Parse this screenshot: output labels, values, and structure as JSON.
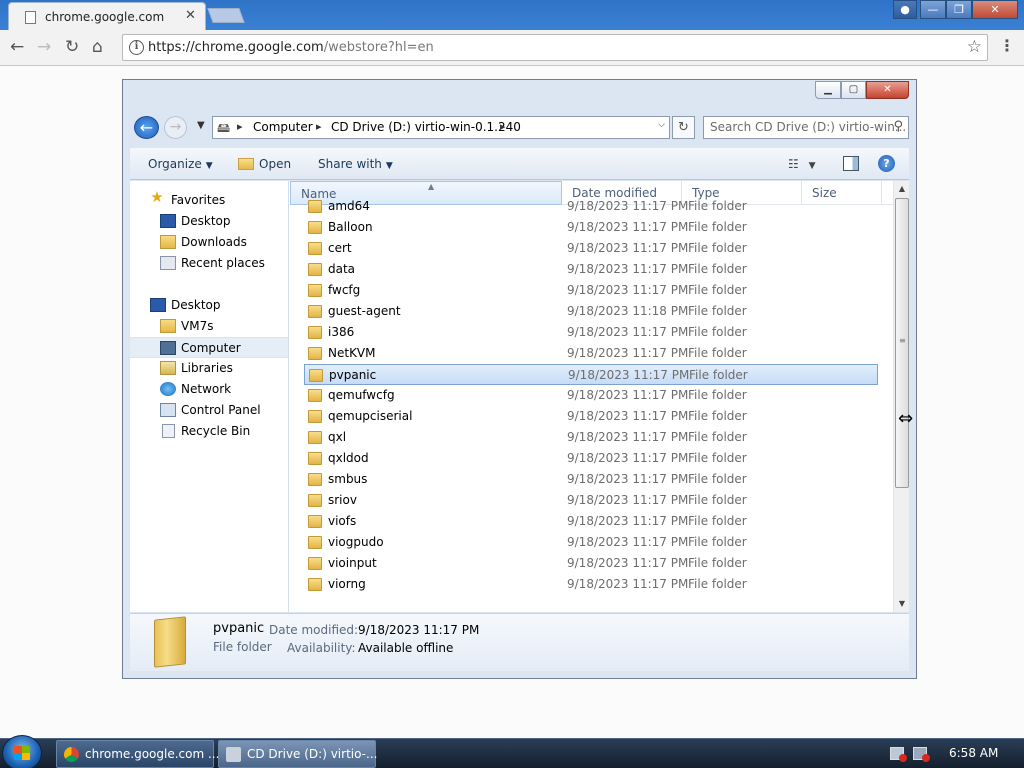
{
  "browser": {
    "tab_title": "chrome.google.com",
    "tab_close": "✕",
    "url_host": "https://chrome.google.com",
    "url_path": "/webstore?hl=en",
    "window_buttons": {
      "min": "—",
      "max": "❐",
      "close": "✕"
    }
  },
  "explorer": {
    "address": {
      "crumbs": [
        "Computer",
        "CD Drive (D:) virtio-win-0.1.240"
      ]
    },
    "search_placeholder": "Search CD Drive (D:) virtio-win...",
    "commands": {
      "organize": "Organize",
      "open": "Open",
      "share_with": "Share with"
    },
    "nav": {
      "favorites": "Favorites",
      "favorites_items": [
        "Desktop",
        "Downloads",
        "Recent places"
      ],
      "desktop": "Desktop",
      "desktop_items": [
        "VM7s",
        "Computer",
        "Libraries",
        "Network",
        "Control Panel",
        "Recycle Bin"
      ],
      "selected": "Computer"
    },
    "columns": {
      "name": "Name",
      "date": "Date modified",
      "type": "Type",
      "size": "Size"
    },
    "files": [
      {
        "name": "amd64",
        "date": "9/18/2023 11:17 PM",
        "type": "File folder"
      },
      {
        "name": "Balloon",
        "date": "9/18/2023 11:17 PM",
        "type": "File folder"
      },
      {
        "name": "cert",
        "date": "9/18/2023 11:17 PM",
        "type": "File folder"
      },
      {
        "name": "data",
        "date": "9/18/2023 11:17 PM",
        "type": "File folder"
      },
      {
        "name": "fwcfg",
        "date": "9/18/2023 11:17 PM",
        "type": "File folder"
      },
      {
        "name": "guest-agent",
        "date": "9/18/2023 11:18 PM",
        "type": "File folder"
      },
      {
        "name": "i386",
        "date": "9/18/2023 11:17 PM",
        "type": "File folder"
      },
      {
        "name": "NetKVM",
        "date": "9/18/2023 11:17 PM",
        "type": "File folder"
      },
      {
        "name": "pvpanic",
        "date": "9/18/2023 11:17 PM",
        "type": "File folder"
      },
      {
        "name": "qemufwcfg",
        "date": "9/18/2023 11:17 PM",
        "type": "File folder"
      },
      {
        "name": "qemupciserial",
        "date": "9/18/2023 11:17 PM",
        "type": "File folder"
      },
      {
        "name": "qxl",
        "date": "9/18/2023 11:17 PM",
        "type": "File folder"
      },
      {
        "name": "qxldod",
        "date": "9/18/2023 11:17 PM",
        "type": "File folder"
      },
      {
        "name": "smbus",
        "date": "9/18/2023 11:17 PM",
        "type": "File folder"
      },
      {
        "name": "sriov",
        "date": "9/18/2023 11:17 PM",
        "type": "File folder"
      },
      {
        "name": "viofs",
        "date": "9/18/2023 11:17 PM",
        "type": "File folder"
      },
      {
        "name": "viogpudo",
        "date": "9/18/2023 11:17 PM",
        "type": "File folder"
      },
      {
        "name": "vioinput",
        "date": "9/18/2023 11:17 PM",
        "type": "File folder"
      },
      {
        "name": "viorng",
        "date": "9/18/2023 11:17 PM",
        "type": "File folder"
      }
    ],
    "selected_file": "pvpanic",
    "details": {
      "name": "pvpanic",
      "type": "File folder",
      "date_key": "Date modified:",
      "date_val": "9/18/2023 11:17 PM",
      "avail_key": "Availability:",
      "avail_val": "Available offline"
    }
  },
  "taskbar": {
    "tasks": [
      "chrome.google.com ...",
      "CD Drive (D:) virtio-..."
    ],
    "clock": "6:58 AM"
  }
}
